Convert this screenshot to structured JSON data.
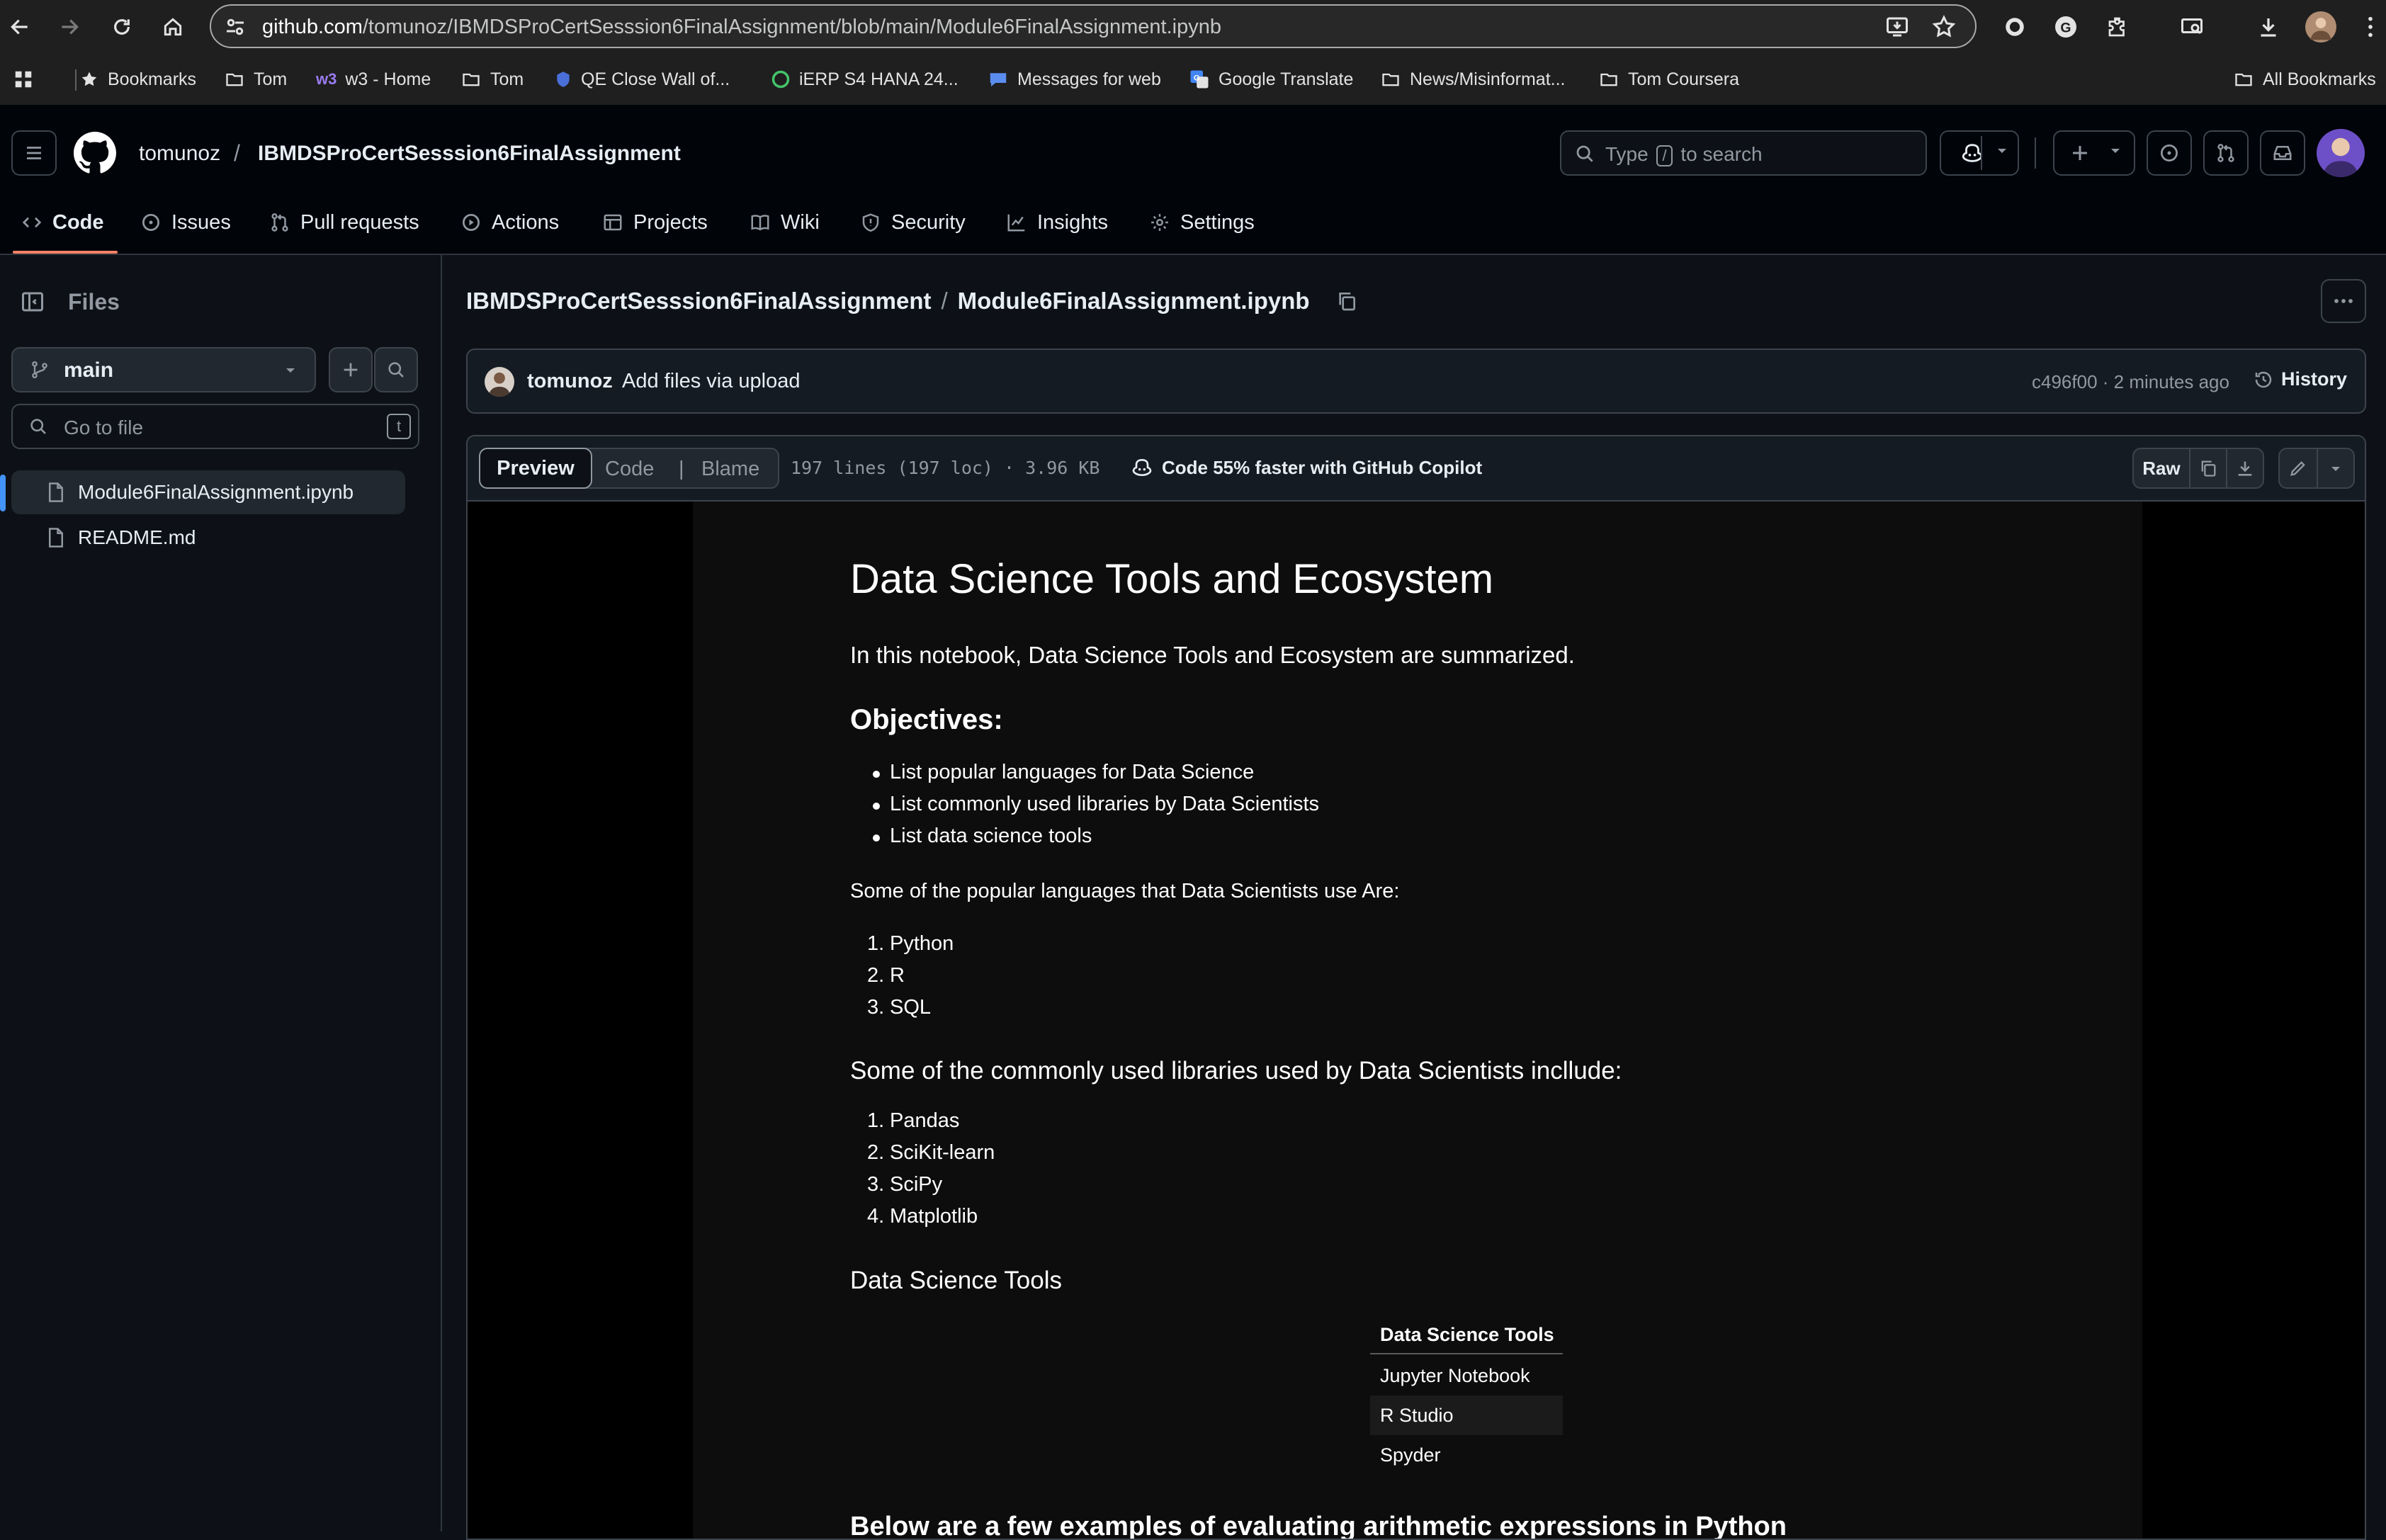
{
  "browser": {
    "url_host": "github.com",
    "url_path": "/tomunoz/IBMDSProCertSesssion6FinalAssignment/blob/main/Module6FinalAssignment.ipynb",
    "bookmarks": [
      {
        "label": "Bookmarks",
        "icon": "star-icon"
      },
      {
        "label": "Tom",
        "icon": "folder-icon"
      },
      {
        "label": "w3 - Home",
        "icon": "w3-icon"
      },
      {
        "label": "Tom",
        "icon": "folder-icon"
      },
      {
        "label": "QE Close Wall of...",
        "icon": "shield-icon"
      },
      {
        "label": "iERP S4 HANA 24...",
        "icon": "globe-icon"
      },
      {
        "label": "Messages for web",
        "icon": "messages-icon"
      },
      {
        "label": "Google Translate",
        "icon": "translate-icon"
      },
      {
        "label": "News/Misinformat...",
        "icon": "folder-icon"
      },
      {
        "label": "Tom Coursera",
        "icon": "folder-icon"
      }
    ],
    "all_bookmarks": "All Bookmarks"
  },
  "header": {
    "owner": "tomunoz",
    "separator": "/",
    "repo": "IBMDSProCertSesssion6FinalAssignment",
    "search_type": "Type",
    "search_key": "/",
    "search_rest": "to search"
  },
  "tabs": [
    {
      "label": "Code",
      "icon": "code-icon",
      "active": true
    },
    {
      "label": "Issues",
      "icon": "issue-icon"
    },
    {
      "label": "Pull requests",
      "icon": "pull-request-icon"
    },
    {
      "label": "Actions",
      "icon": "play-icon"
    },
    {
      "label": "Projects",
      "icon": "table-icon"
    },
    {
      "label": "Wiki",
      "icon": "book-icon"
    },
    {
      "label": "Security",
      "icon": "shield-icon"
    },
    {
      "label": "Insights",
      "icon": "graph-icon"
    },
    {
      "label": "Settings",
      "icon": "gear-icon"
    }
  ],
  "sidebar": {
    "title": "Files",
    "branch": "main",
    "goto_placeholder": "Go to file",
    "goto_shortcut": "t",
    "files": [
      {
        "name": "Module6FinalAssignment.ipynb",
        "active": true
      },
      {
        "name": "README.md",
        "active": false
      }
    ]
  },
  "file": {
    "repo": "IBMDSProCertSesssion6FinalAssignment",
    "separator": "/",
    "filename": "Module6FinalAssignment.ipynb",
    "commit": {
      "author": "tomunoz",
      "message": "Add files via upload",
      "meta": "c496f00 · 2 minutes ago",
      "history": "History"
    },
    "view_preview": "Preview",
    "view_code": "Code",
    "view_blame": "Blame",
    "stats": "197 lines (197 loc) · 3.96 KB",
    "copilot": "Code 55% faster with GitHub Copilot",
    "raw": "Raw"
  },
  "notebook": {
    "title": "Data Science Tools and Ecosystem",
    "intro": "In this notebook, Data Science Tools and Ecosystem are summarized.",
    "objectives_heading": "Objectives:",
    "objectives": [
      "List popular languages for Data Science",
      "List commonly used libraries by Data Scientists",
      "List data science tools"
    ],
    "languages_intro": "Some of the popular languages that Data Scientists use Are:",
    "languages": [
      "Python",
      "R",
      "SQL"
    ],
    "libraries_heading": "Some of the commonly used libraries used by Data Scientists incllude:",
    "libraries": [
      "Pandas",
      "SciKit-learn",
      "SciPy",
      "Matplotlib"
    ],
    "tools_heading": "Data Science Tools",
    "tools_table_header": "Data Science Tools",
    "tools": [
      "Jupyter Notebook",
      "R Studio",
      "Spyder"
    ],
    "next_heading": "Below are a few examples of evaluating arithmetic expressions in Python"
  }
}
